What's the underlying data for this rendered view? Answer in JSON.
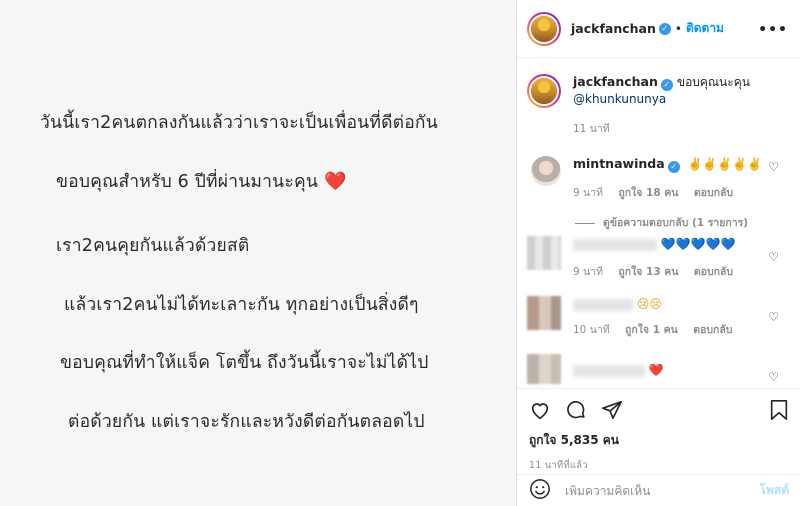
{
  "post": {
    "lines": [
      "วันนี้เรา2คนตกลงกันแล้วว่าเราจะเป็นเพื่อนที่ดีต่อกัน",
      "ขอบคุณสำหรับ 6 ปีที่ผ่านมานะคุน",
      "เรา2คนคุยกันแล้วด้วยสติ",
      "แล้วเรา2คนไม่ได้ทะเลาะกัน ทุกอย่างเป็นสิ่งดีๆ",
      "ขอบคุณที่ทำให้แจ็ค โตขึ้น  ถึงวันนี้เราจะไม่ได้ไป",
      "ต่อด้วยกัน แต่เราจะรักและหวังดีต่อกันตลอดไป"
    ],
    "heart": "❤️"
  },
  "header": {
    "username": "jackfanchan",
    "separator": "•",
    "follow_label": "ติดตาม",
    "more_label": "•••"
  },
  "caption": {
    "username": "jackfanchan",
    "text": "ขอบคุณนะคุน",
    "mention": "@khunkununya",
    "time": "11 นาที"
  },
  "comments": [
    {
      "username": "mintnawinda",
      "text": "✌️✌️✌️✌️✌️",
      "time": "9 นาที",
      "likes": "ถูกใจ 18 คน",
      "reply": "ตอบกลับ"
    },
    {
      "username": "",
      "text": "💙💙💙💙💙",
      "time": "9 นาที",
      "likes": "ถูกใจ 13 คน",
      "reply": "ตอบกลับ"
    },
    {
      "username": "",
      "text": "😢😢",
      "time": "10 นาที",
      "likes": "ถูกใจ 1 คน",
      "reply": "ตอบกลับ"
    },
    {
      "username": "",
      "text": "❤️"
    }
  ],
  "view_replies": "ดูข้อความตอบกลับ (1 รายการ)",
  "actions": {
    "likes": "ถูกใจ 5,835 คน",
    "time": "11 นาทีที่แล้ว"
  },
  "composer": {
    "placeholder": "เพิ่มความคิดเห็น",
    "post_label": "โพสต์"
  },
  "colors": {
    "accent": "#0095f6",
    "verified": "#3897f0",
    "mention": "#00376b",
    "muted": "#8e8e8e"
  }
}
